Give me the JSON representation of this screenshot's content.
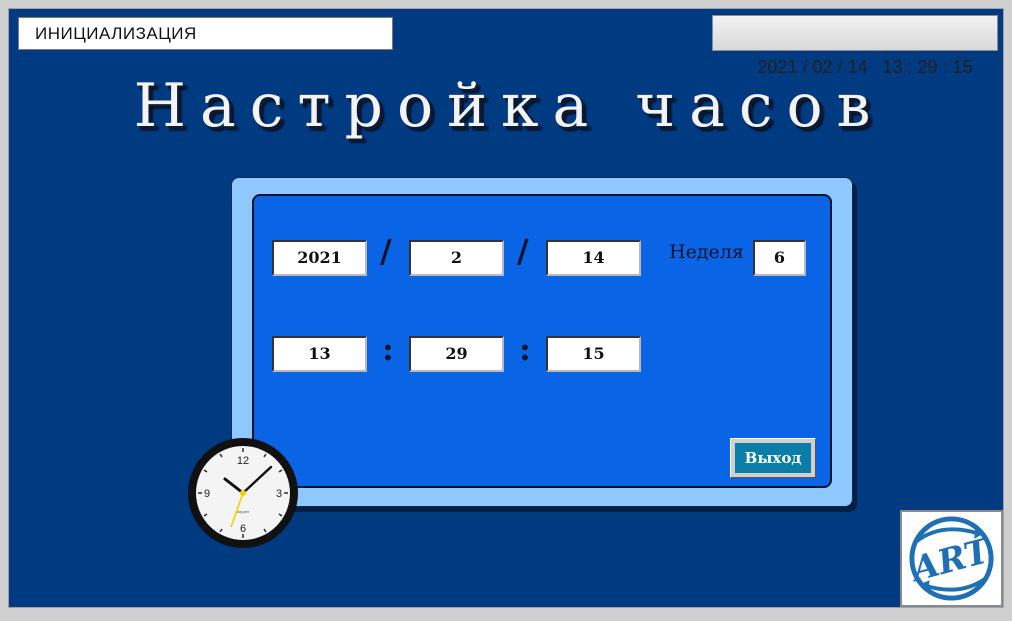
{
  "header": {
    "status": "ИНИЦИАЛИЗАЦИЯ",
    "datetime": "2021 / 02 / 14   13 : 29 : 15"
  },
  "title": "Настройка часов",
  "date": {
    "year": "2021",
    "month": "2",
    "day": "14",
    "separator": "/"
  },
  "week": {
    "label": "Неделя",
    "value": "6"
  },
  "time": {
    "hour": "13",
    "minute": "29",
    "second": "15",
    "separator": ":"
  },
  "exit_button": "Выход",
  "clock": {
    "numerals": [
      "12",
      "3",
      "6",
      "9"
    ],
    "brand": "anpper",
    "hand_color": "#f0d000"
  },
  "colors": {
    "background": "#003a80",
    "panel_outer": "#8ec8ff",
    "panel_inner": "#0a64e6",
    "button": "#0a7ea8"
  }
}
